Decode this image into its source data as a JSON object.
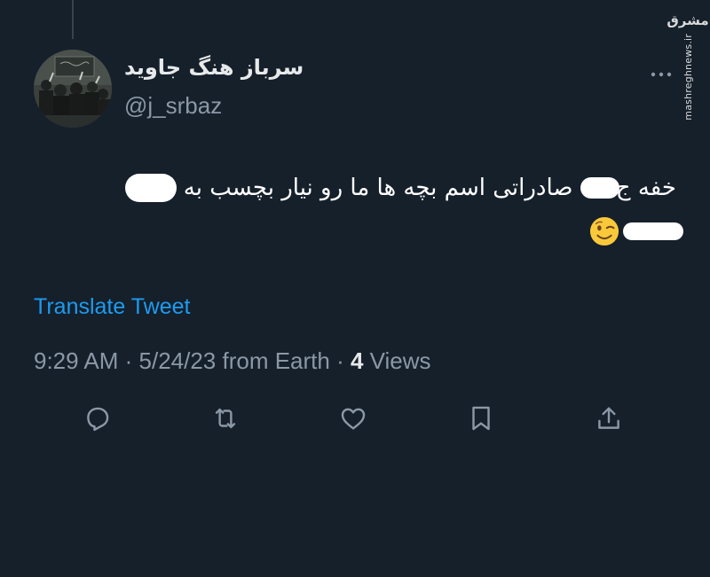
{
  "watermark": {
    "logo": "مشرق",
    "url": "mashreghnews.ir"
  },
  "tweet": {
    "author": {
      "display_name": "سرباز هنگ جاوید",
      "handle": "@j_srbaz"
    },
    "text": {
      "line1_word_a": "خفه",
      "line1_word_b": "ج",
      "line1_rest": "صادراتی اسم بچه ها ما رو نیار بچسب به",
      "line2_emoji": "wink-emoji"
    },
    "translate_label": "Translate Tweet",
    "meta": {
      "time": "9:29 AM",
      "sep1": " · ",
      "date": "5/24/23",
      "source": " from Earth",
      "sep2": " · ",
      "views_count": "4",
      "views_label": " Views"
    },
    "actions": [
      {
        "name": "reply",
        "icon": "reply-icon"
      },
      {
        "name": "retweet",
        "icon": "retweet-icon"
      },
      {
        "name": "like",
        "icon": "heart-icon"
      },
      {
        "name": "bookmark",
        "icon": "bookmark-icon"
      },
      {
        "name": "share",
        "icon": "share-icon"
      }
    ]
  },
  "colors": {
    "background": "#15202b",
    "primary_text": "#e7e9ea",
    "secondary_text": "#8b98a5",
    "link": "#1d9bf0"
  }
}
